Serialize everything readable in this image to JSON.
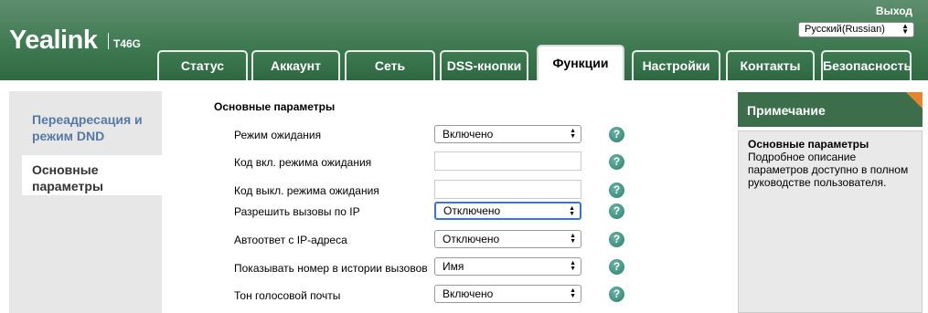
{
  "header": {
    "logo": "Yealink",
    "model": "T46G",
    "logout": "Выход",
    "language": "Русский(Russian)"
  },
  "tabs": [
    {
      "label": "Статус"
    },
    {
      "label": "Аккаунт"
    },
    {
      "label": "Сеть"
    },
    {
      "label": "DSS-кнопки"
    },
    {
      "label": "Функции",
      "active": true
    },
    {
      "label": "Настройки"
    },
    {
      "label": "Контакты"
    },
    {
      "label": "Безопасность"
    }
  ],
  "leftnav": {
    "items": [
      {
        "label": "Переадресация и режим DND"
      },
      {
        "label": "Основные параметры",
        "active": true
      }
    ]
  },
  "main": {
    "title": "Основные параметры",
    "rows": [
      {
        "label": "Режим ожидания",
        "type": "select",
        "value": "Включено"
      },
      {
        "label": "Код вкл. режима ожидания",
        "type": "text",
        "value": ""
      },
      {
        "label": "Код выкл. режима ожидания",
        "type": "text",
        "value": ""
      },
      {
        "label": "Разрешить вызовы по IP",
        "type": "select",
        "value": "Отключено"
      },
      {
        "label": "Автоответ с IP-адреса",
        "type": "select",
        "value": "Отключено"
      },
      {
        "label": "Показывать номер в истории вызовов",
        "type": "select",
        "value": "Имя"
      },
      {
        "label": "Тон голосовой почты",
        "type": "select",
        "value": "Включено"
      }
    ],
    "help_glyph": "?"
  },
  "note": {
    "heading": "Примечание",
    "title": "Основные параметры",
    "text": "Подробное описание параметров доступно в полном руководстве пользователя."
  },
  "colors": {
    "header_green": "#3f7a52",
    "nav_text": "#5679a4",
    "note_head": "#3d6e4c",
    "note_corner": "#e8842f",
    "help_icon": "#3a8a78"
  }
}
